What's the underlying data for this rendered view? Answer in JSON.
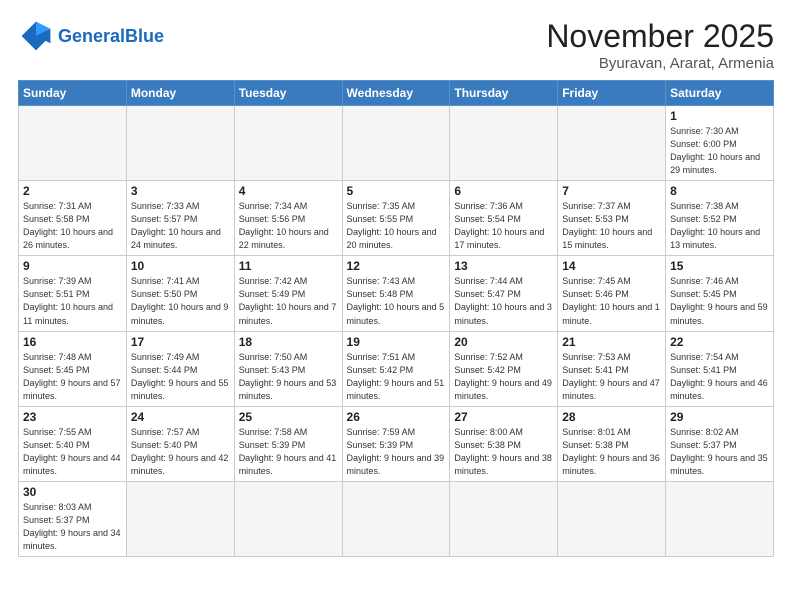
{
  "header": {
    "logo_general": "General",
    "logo_blue": "Blue",
    "month_title": "November 2025",
    "location": "Byuravan, Ararat, Armenia"
  },
  "weekdays": [
    "Sunday",
    "Monday",
    "Tuesday",
    "Wednesday",
    "Thursday",
    "Friday",
    "Saturday"
  ],
  "weeks": [
    [
      {
        "day": "",
        "info": ""
      },
      {
        "day": "",
        "info": ""
      },
      {
        "day": "",
        "info": ""
      },
      {
        "day": "",
        "info": ""
      },
      {
        "day": "",
        "info": ""
      },
      {
        "day": "",
        "info": ""
      },
      {
        "day": "1",
        "info": "Sunrise: 7:30 AM\nSunset: 6:00 PM\nDaylight: 10 hours\nand 29 minutes."
      }
    ],
    [
      {
        "day": "2",
        "info": "Sunrise: 7:31 AM\nSunset: 5:58 PM\nDaylight: 10 hours\nand 26 minutes."
      },
      {
        "day": "3",
        "info": "Sunrise: 7:33 AM\nSunset: 5:57 PM\nDaylight: 10 hours\nand 24 minutes."
      },
      {
        "day": "4",
        "info": "Sunrise: 7:34 AM\nSunset: 5:56 PM\nDaylight: 10 hours\nand 22 minutes."
      },
      {
        "day": "5",
        "info": "Sunrise: 7:35 AM\nSunset: 5:55 PM\nDaylight: 10 hours\nand 20 minutes."
      },
      {
        "day": "6",
        "info": "Sunrise: 7:36 AM\nSunset: 5:54 PM\nDaylight: 10 hours\nand 17 minutes."
      },
      {
        "day": "7",
        "info": "Sunrise: 7:37 AM\nSunset: 5:53 PM\nDaylight: 10 hours\nand 15 minutes."
      },
      {
        "day": "8",
        "info": "Sunrise: 7:38 AM\nSunset: 5:52 PM\nDaylight: 10 hours\nand 13 minutes."
      }
    ],
    [
      {
        "day": "9",
        "info": "Sunrise: 7:39 AM\nSunset: 5:51 PM\nDaylight: 10 hours\nand 11 minutes."
      },
      {
        "day": "10",
        "info": "Sunrise: 7:41 AM\nSunset: 5:50 PM\nDaylight: 10 hours\nand 9 minutes."
      },
      {
        "day": "11",
        "info": "Sunrise: 7:42 AM\nSunset: 5:49 PM\nDaylight: 10 hours\nand 7 minutes."
      },
      {
        "day": "12",
        "info": "Sunrise: 7:43 AM\nSunset: 5:48 PM\nDaylight: 10 hours\nand 5 minutes."
      },
      {
        "day": "13",
        "info": "Sunrise: 7:44 AM\nSunset: 5:47 PM\nDaylight: 10 hours\nand 3 minutes."
      },
      {
        "day": "14",
        "info": "Sunrise: 7:45 AM\nSunset: 5:46 PM\nDaylight: 10 hours\nand 1 minute."
      },
      {
        "day": "15",
        "info": "Sunrise: 7:46 AM\nSunset: 5:45 PM\nDaylight: 9 hours\nand 59 minutes."
      }
    ],
    [
      {
        "day": "16",
        "info": "Sunrise: 7:48 AM\nSunset: 5:45 PM\nDaylight: 9 hours\nand 57 minutes."
      },
      {
        "day": "17",
        "info": "Sunrise: 7:49 AM\nSunset: 5:44 PM\nDaylight: 9 hours\nand 55 minutes."
      },
      {
        "day": "18",
        "info": "Sunrise: 7:50 AM\nSunset: 5:43 PM\nDaylight: 9 hours\nand 53 minutes."
      },
      {
        "day": "19",
        "info": "Sunrise: 7:51 AM\nSunset: 5:42 PM\nDaylight: 9 hours\nand 51 minutes."
      },
      {
        "day": "20",
        "info": "Sunrise: 7:52 AM\nSunset: 5:42 PM\nDaylight: 9 hours\nand 49 minutes."
      },
      {
        "day": "21",
        "info": "Sunrise: 7:53 AM\nSunset: 5:41 PM\nDaylight: 9 hours\nand 47 minutes."
      },
      {
        "day": "22",
        "info": "Sunrise: 7:54 AM\nSunset: 5:41 PM\nDaylight: 9 hours\nand 46 minutes."
      }
    ],
    [
      {
        "day": "23",
        "info": "Sunrise: 7:55 AM\nSunset: 5:40 PM\nDaylight: 9 hours\nand 44 minutes."
      },
      {
        "day": "24",
        "info": "Sunrise: 7:57 AM\nSunset: 5:40 PM\nDaylight: 9 hours\nand 42 minutes."
      },
      {
        "day": "25",
        "info": "Sunrise: 7:58 AM\nSunset: 5:39 PM\nDaylight: 9 hours\nand 41 minutes."
      },
      {
        "day": "26",
        "info": "Sunrise: 7:59 AM\nSunset: 5:39 PM\nDaylight: 9 hours\nand 39 minutes."
      },
      {
        "day": "27",
        "info": "Sunrise: 8:00 AM\nSunset: 5:38 PM\nDaylight: 9 hours\nand 38 minutes."
      },
      {
        "day": "28",
        "info": "Sunrise: 8:01 AM\nSunset: 5:38 PM\nDaylight: 9 hours\nand 36 minutes."
      },
      {
        "day": "29",
        "info": "Sunrise: 8:02 AM\nSunset: 5:37 PM\nDaylight: 9 hours\nand 35 minutes."
      }
    ],
    [
      {
        "day": "30",
        "info": "Sunrise: 8:03 AM\nSunset: 5:37 PM\nDaylight: 9 hours\nand 34 minutes."
      },
      {
        "day": "",
        "info": ""
      },
      {
        "day": "",
        "info": ""
      },
      {
        "day": "",
        "info": ""
      },
      {
        "day": "",
        "info": ""
      },
      {
        "day": "",
        "info": ""
      },
      {
        "day": "",
        "info": ""
      }
    ]
  ]
}
